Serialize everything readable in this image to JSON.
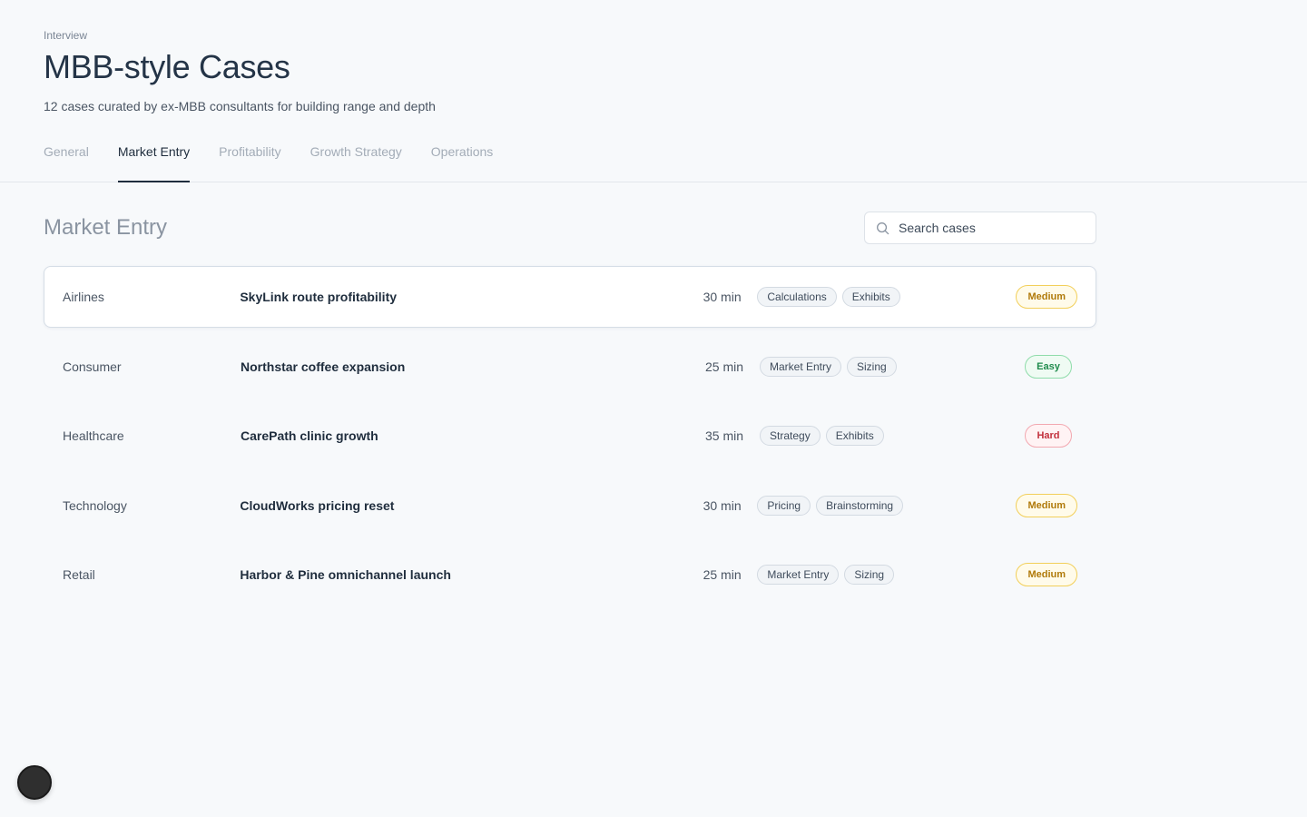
{
  "header": {
    "eyebrow": "Interview",
    "title": "MBB-style Cases",
    "subtitle": "12 cases curated by ex-MBB consultants for building range and depth"
  },
  "tabs": [
    {
      "label": "General",
      "active": false
    },
    {
      "label": "Market Entry",
      "active": true
    },
    {
      "label": "Profitability",
      "active": false
    },
    {
      "label": "Growth Strategy",
      "active": false
    },
    {
      "label": "Operations",
      "active": false
    }
  ],
  "section": {
    "title": "Market Entry",
    "search_placeholder": "Search cases",
    "search_icon": "search-icon"
  },
  "cases": [
    {
      "category": "Airlines",
      "name": "SkyLink route profitability",
      "duration": "30 min",
      "tags": [
        "Calculations",
        "Exhibits"
      ],
      "difficulty": "Medium",
      "level": "medium",
      "selected": true
    },
    {
      "category": "Consumer",
      "name": "Northstar coffee expansion",
      "duration": "25 min",
      "tags": [
        "Market Entry",
        "Sizing"
      ],
      "difficulty": "Easy",
      "level": "easy",
      "selected": false
    },
    {
      "category": "Healthcare",
      "name": "CarePath clinic growth",
      "duration": "35 min",
      "tags": [
        "Strategy",
        "Exhibits"
      ],
      "difficulty": "Hard",
      "level": "hard",
      "selected": false
    },
    {
      "category": "Technology",
      "name": "CloudWorks pricing reset",
      "duration": "30 min",
      "tags": [
        "Pricing",
        "Brainstorming"
      ],
      "difficulty": "Medium",
      "level": "medium",
      "selected": false
    },
    {
      "category": "Retail",
      "name": "Harbor & Pine omnichannel launch",
      "duration": "25 min",
      "tags": [
        "Market Entry",
        "Sizing"
      ],
      "difficulty": "Medium",
      "level": "medium",
      "selected": false
    }
  ],
  "colors": {
    "background": "#f7f9fb",
    "text": "#1f2d3d",
    "medium": "#b07a0a",
    "easy": "#1f8b4c",
    "hard": "#c2303c"
  }
}
